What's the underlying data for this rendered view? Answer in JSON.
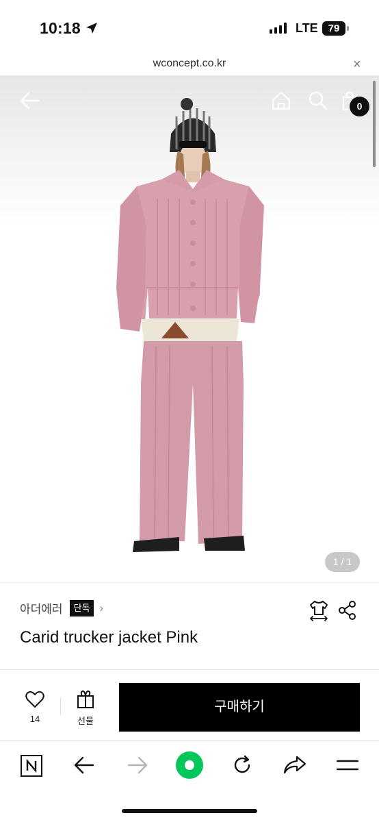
{
  "status_bar": {
    "time": "10:18",
    "network": "LTE",
    "battery": "79"
  },
  "url_bar": {
    "domain": "wconcept.co.kr",
    "close_glyph": "×"
  },
  "image_header": {
    "cart_count": "0",
    "image_counter": "1 / 1"
  },
  "product": {
    "brand": "아더에러",
    "exclusive_badge": "단독",
    "brand_chevron": "›",
    "name": "Carid trucker jacket Pink"
  },
  "purchase_bar": {
    "like_count": "14",
    "gift_label": "선물",
    "buy_label": "구매하기"
  },
  "colors": {
    "jacket_pink": "#d8a0ad",
    "buy_button": "#000000",
    "naver_green": "#03c75a"
  }
}
